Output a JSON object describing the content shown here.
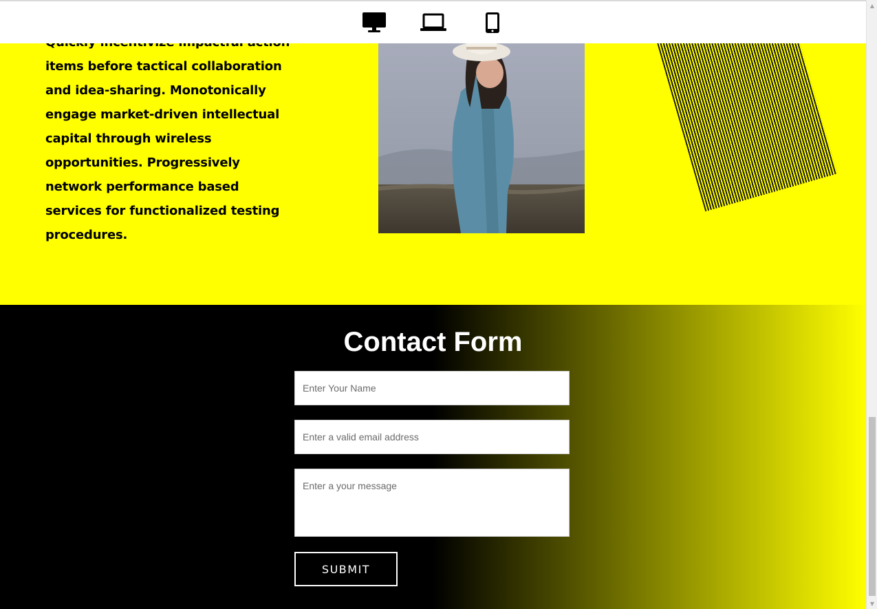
{
  "toolbar": {
    "devices": [
      {
        "name": "desktop",
        "icon": "desktop-icon"
      },
      {
        "name": "laptop",
        "icon": "laptop-icon"
      },
      {
        "name": "mobile",
        "icon": "mobile-icon"
      }
    ]
  },
  "hero": {
    "paragraph": "Quickly incentivize impactful action items before tactical collaboration and idea-sharing. Monotonically engage market-driven intellectual capital through wireless opportunities. Progressively network performance based services for functionalized testing procedures.",
    "photo": "woman-in-white-hat-photo",
    "accent_color": "#ffff00"
  },
  "contact": {
    "title": "Contact Form",
    "name_placeholder": "Enter Your Name",
    "email_placeholder": "Enter a valid email address",
    "message_placeholder": "Enter a your message",
    "submit_label": "SUBMIT",
    "gradient": [
      "#000000",
      "#ffff00"
    ]
  }
}
